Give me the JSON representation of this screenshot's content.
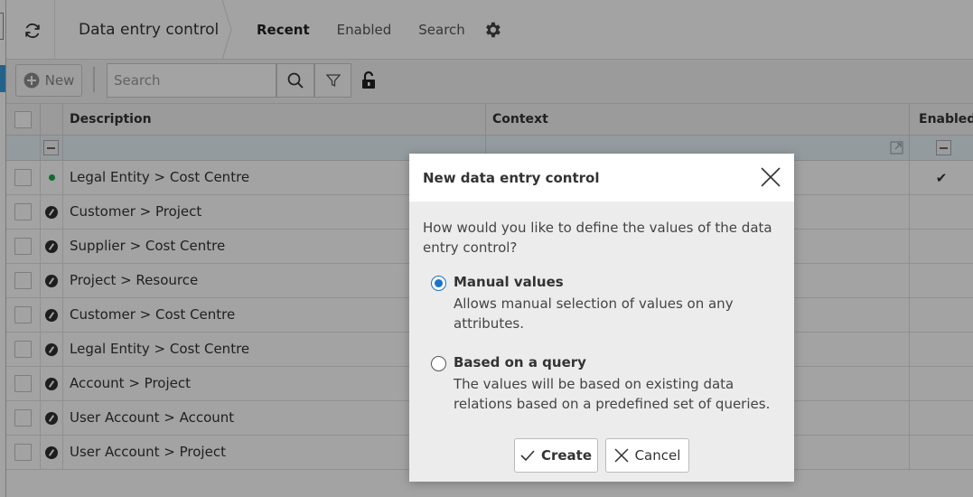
{
  "header": {
    "title": "Data entry control",
    "tabs": [
      {
        "label": "Recent",
        "active": true
      },
      {
        "label": "Enabled",
        "active": false
      },
      {
        "label": "Search",
        "active": false
      }
    ]
  },
  "toolbar": {
    "new_label": "New",
    "search_placeholder": "Search"
  },
  "grid": {
    "columns": {
      "description": "Description",
      "context": "Context",
      "enabled": "Enabled"
    },
    "rows": [
      {
        "description": "Legal Entity > Cost Centre",
        "status": "green-dot",
        "enabled": "✔"
      },
      {
        "description": "Customer > Project",
        "status": "pencil",
        "enabled": ""
      },
      {
        "description": "Supplier > Cost Centre",
        "status": "pencil",
        "enabled": ""
      },
      {
        "description": "Project > Resource",
        "status": "pencil",
        "enabled": ""
      },
      {
        "description": "Customer > Cost Centre",
        "status": "pencil",
        "enabled": ""
      },
      {
        "description": "Legal Entity > Cost Centre",
        "status": "pencil",
        "enabled": ""
      },
      {
        "description": "Account > Project",
        "status": "pencil",
        "enabled": ""
      },
      {
        "description": "User Account > Account",
        "status": "pencil",
        "enabled": ""
      },
      {
        "description": "User Account > Project",
        "status": "pencil",
        "enabled": ""
      }
    ]
  },
  "modal": {
    "title": "New data entry control",
    "question": "How would you like to define the values of the data entry control?",
    "options": [
      {
        "label": "Manual values",
        "description": "Allows manual selection of values on any attributes.",
        "selected": true
      },
      {
        "label": "Based on a query",
        "description": "The values will be based on existing data relations based on a predefined set of queries.",
        "selected": false
      }
    ],
    "create_label": "Create",
    "cancel_label": "Cancel"
  },
  "colors": {
    "accent": "#1a73c9",
    "enabled_dot": "#1ea64b",
    "filter_row": "#e7f3f9"
  }
}
